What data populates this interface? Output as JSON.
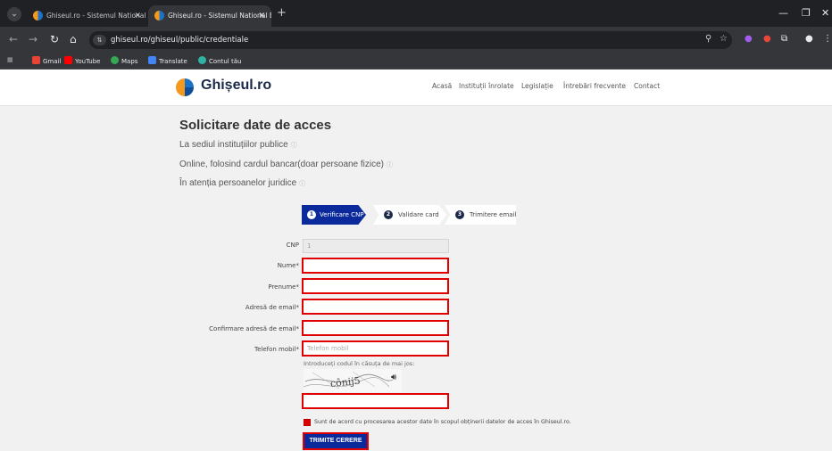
{
  "browser": {
    "tabs": [
      {
        "title": "Ghiseul.ro - Sistemul National E",
        "active": false
      },
      {
        "title": "Ghiseul.ro - Sistemul National E",
        "active": true
      }
    ],
    "url": "ghiseul.ro/ghiseul/public/credentiale",
    "bookmarks": [
      "Gmail",
      "YouTube",
      "Maps",
      "Translate",
      "Contul tău"
    ]
  },
  "header": {
    "logo_text": "Ghișeul.ro",
    "nav": [
      "Acasă",
      "Instituții înrolate",
      "Legislație",
      "Întrebări frecvente",
      "Contact"
    ]
  },
  "main": {
    "title": "Solicitare date de acces",
    "options": [
      "La sediul instituțiilor publice",
      "Online, folosind cardul bancar(doar persoane fizice)",
      "În atenția persoanelor juridice"
    ],
    "info_glyph": "ⓘ",
    "steps": [
      {
        "num": "1",
        "label": "Verificare CNP"
      },
      {
        "num": "2",
        "label": "Validare card"
      },
      {
        "num": "3",
        "label": "Trimitere email"
      }
    ]
  },
  "form": {
    "cnp_label": "CNP",
    "cnp_value": "1",
    "nume_label": "Nume*",
    "prenume_label": "Prenume*",
    "email_label": "Adresă de email*",
    "email_confirm_label": "Confirmare adresă de email*",
    "phone_label": "Telefon mobil*",
    "phone_placeholder": "Telefon mobil",
    "captcha_note": "Introduceți codul în căsuța de mai jos:",
    "captcha_text": "cônij5",
    "consent_text": "Sunt de acord cu procesarea acestor date în scopul obținerii datelor de acces în Ghiseul.ro.",
    "submit_label": "TRIMITE CERERE"
  },
  "colors": {
    "primary": "#0a2a9c",
    "error": "#e00000",
    "logo_orange": "#f39a1e",
    "logo_blue": "#1a73c8"
  }
}
